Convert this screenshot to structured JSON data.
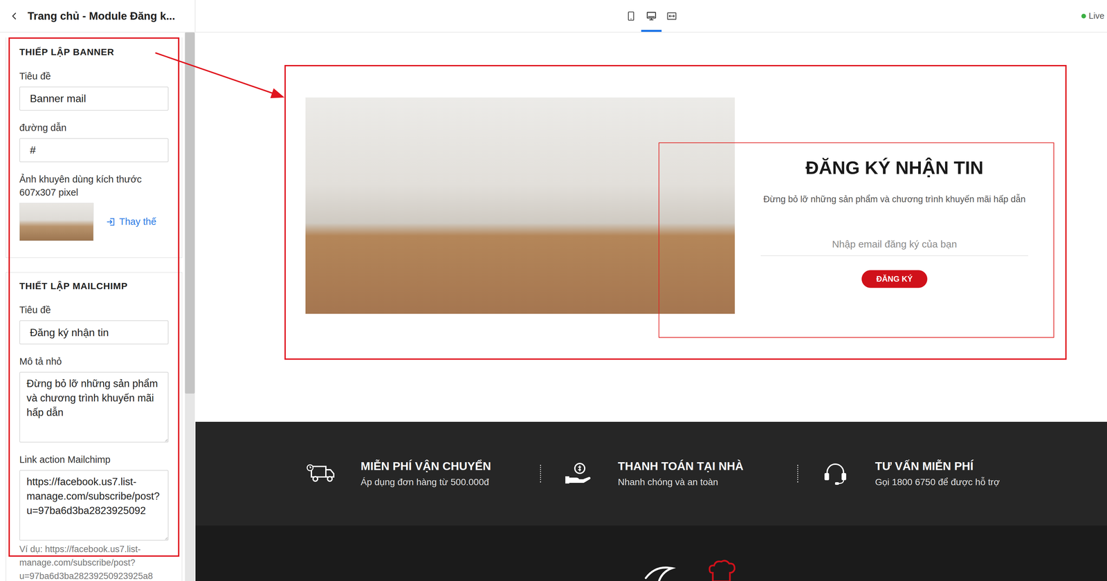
{
  "header": {
    "title": "Trang chủ - Module Đăng k..."
  },
  "view_modes": [
    {
      "kind": "mobile",
      "selected": false
    },
    {
      "kind": "desktop",
      "selected": true
    },
    {
      "kind": "fullwidth",
      "selected": false
    }
  ],
  "status": {
    "label": "Live",
    "online": true
  },
  "sidebar": {
    "sections": [
      {
        "title": "THIẾP LẬP BANNER",
        "fields": [
          {
            "kind": "input",
            "label": "Tiêu đề",
            "value": "Banner mail"
          },
          {
            "kind": "input",
            "label": "đường dẫn",
            "value": "#"
          },
          {
            "kind": "image",
            "label": "Ảnh khuyên dùng kích thước 607x307 pixel",
            "action": "Thay thế"
          }
        ]
      },
      {
        "title": "THIẾT LẬP MAILCHIMP",
        "fields": [
          {
            "kind": "input",
            "label": "Tiêu đề",
            "value": "Đăng ký nhận tin"
          },
          {
            "kind": "textarea",
            "label": "Mô tả nhỏ",
            "value": "Đừng bỏ lỡ những sản phẩm và chương trình khuyến mãi hấp dẫn"
          },
          {
            "kind": "textarea",
            "label": "Link action Mailchimp",
            "value": "https://facebook.us7.list-manage.com/subscribe/post?u=97ba6d3ba2823925092",
            "hint": "Ví dụ: https://facebook.us7.list-manage.com/subscribe/post?u=97ba6d3ba28239250923925a8"
          }
        ]
      }
    ]
  },
  "preview": {
    "newsletter": {
      "title": "ĐĂNG KÝ NHẬN TIN",
      "description": "Đừng bỏ lỡ những sản phẩm và chương trình khuyến mãi hấp dẫn",
      "placeholder": "Nhập email đăng ký của bạn",
      "button": "ĐĂNG KÝ"
    },
    "features": [
      {
        "kind": "shipping",
        "title": "MIỄN PHÍ VẬN CHUYỂN",
        "subtitle": "Áp dụng đơn hàng từ 500.000đ"
      },
      {
        "kind": "payment",
        "title": "THANH TOÁN TẠI NHÀ",
        "subtitle": "Nhanh chóng và an toàn"
      },
      {
        "kind": "support",
        "title": "TƯ VẤN MIỄN PHÍ",
        "subtitle": "Gọi 1800 6750 để được hỗ trợ"
      }
    ]
  }
}
